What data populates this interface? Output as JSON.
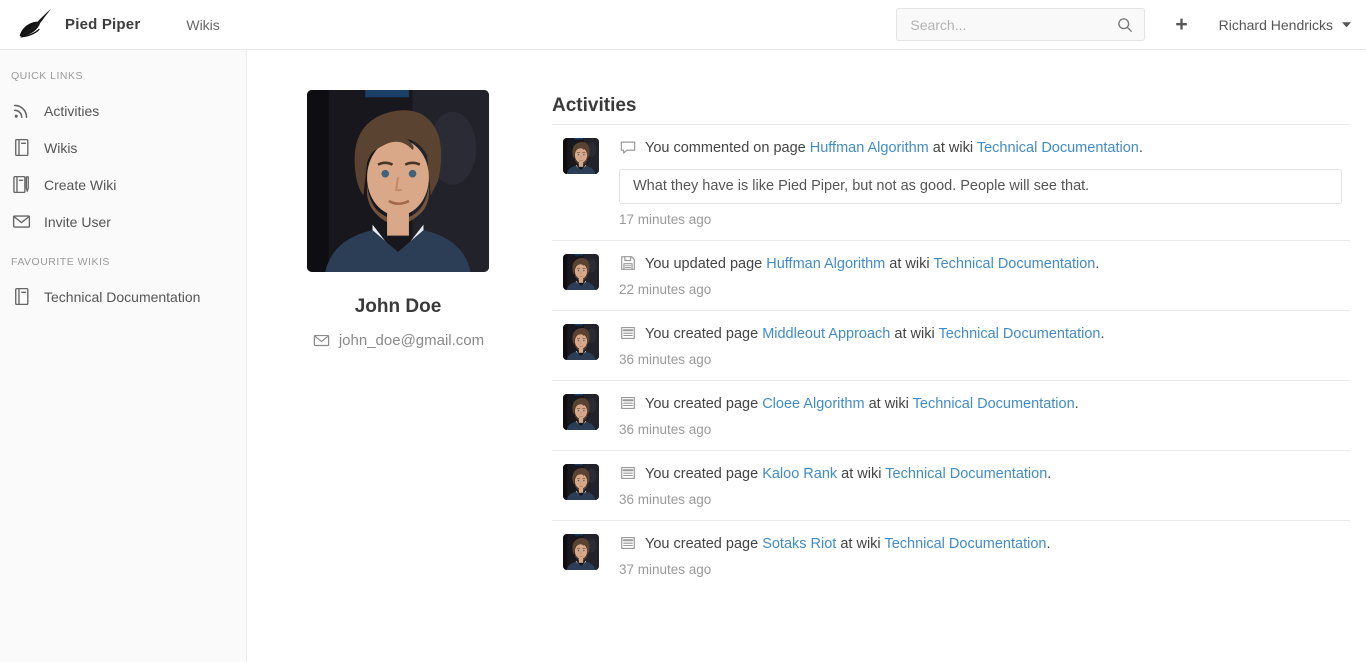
{
  "colors": {
    "link_blue": "#428bca",
    "text_dark": "#3c3c3c",
    "text_gray": "#9a9a9a"
  },
  "navbar": {
    "brand": "Pied Piper",
    "nav_links": [
      "Wikis"
    ],
    "search_placeholder": "Search...",
    "add_label": "+",
    "user_name": "Richard Hendricks"
  },
  "sidebar": {
    "sections": [
      {
        "heading": "QUICK LINKS",
        "items": [
          {
            "icon": "activities-icon",
            "label": "Activities"
          },
          {
            "icon": "wiki-icon",
            "label": "Wikis"
          },
          {
            "icon": "create-wiki-icon",
            "label": "Create Wiki"
          },
          {
            "icon": "invite-user-icon",
            "label": "Invite User"
          }
        ]
      },
      {
        "heading": "FAVOURITE WIKIS",
        "items": [
          {
            "icon": "wiki-icon",
            "label": "Technical Documentation"
          }
        ]
      }
    ]
  },
  "profile": {
    "name": "John Doe",
    "email": "john_doe@gmail.com"
  },
  "activities": {
    "title": "Activities",
    "connector": "at wiki",
    "suffix": ".",
    "items": [
      {
        "icon": "comment-icon",
        "action": "You commented on page",
        "page": "Huffman Algorithm",
        "wiki": "Technical Documentation",
        "comment": "What they have is like Pied Piper, but not as good. People will see that.",
        "time": "17 minutes ago"
      },
      {
        "icon": "save-icon",
        "action": "You updated page",
        "page": "Huffman Algorithm",
        "wiki": "Technical Documentation",
        "time": "22 minutes ago"
      },
      {
        "icon": "page-icon",
        "action": "You created page",
        "page": "Middleout Approach",
        "wiki": "Technical Documentation",
        "time": "36 minutes ago"
      },
      {
        "icon": "page-icon",
        "action": "You created page",
        "page": "Cloee Algorithm",
        "wiki": "Technical Documentation",
        "time": "36 minutes ago"
      },
      {
        "icon": "page-icon",
        "action": "You created page",
        "page": "Kaloo Rank",
        "wiki": "Technical Documentation",
        "time": "36 minutes ago"
      },
      {
        "icon": "page-icon",
        "action": "You created page",
        "page": "Sotaks Riot",
        "wiki": "Technical Documentation",
        "time": "37 minutes ago"
      }
    ]
  }
}
